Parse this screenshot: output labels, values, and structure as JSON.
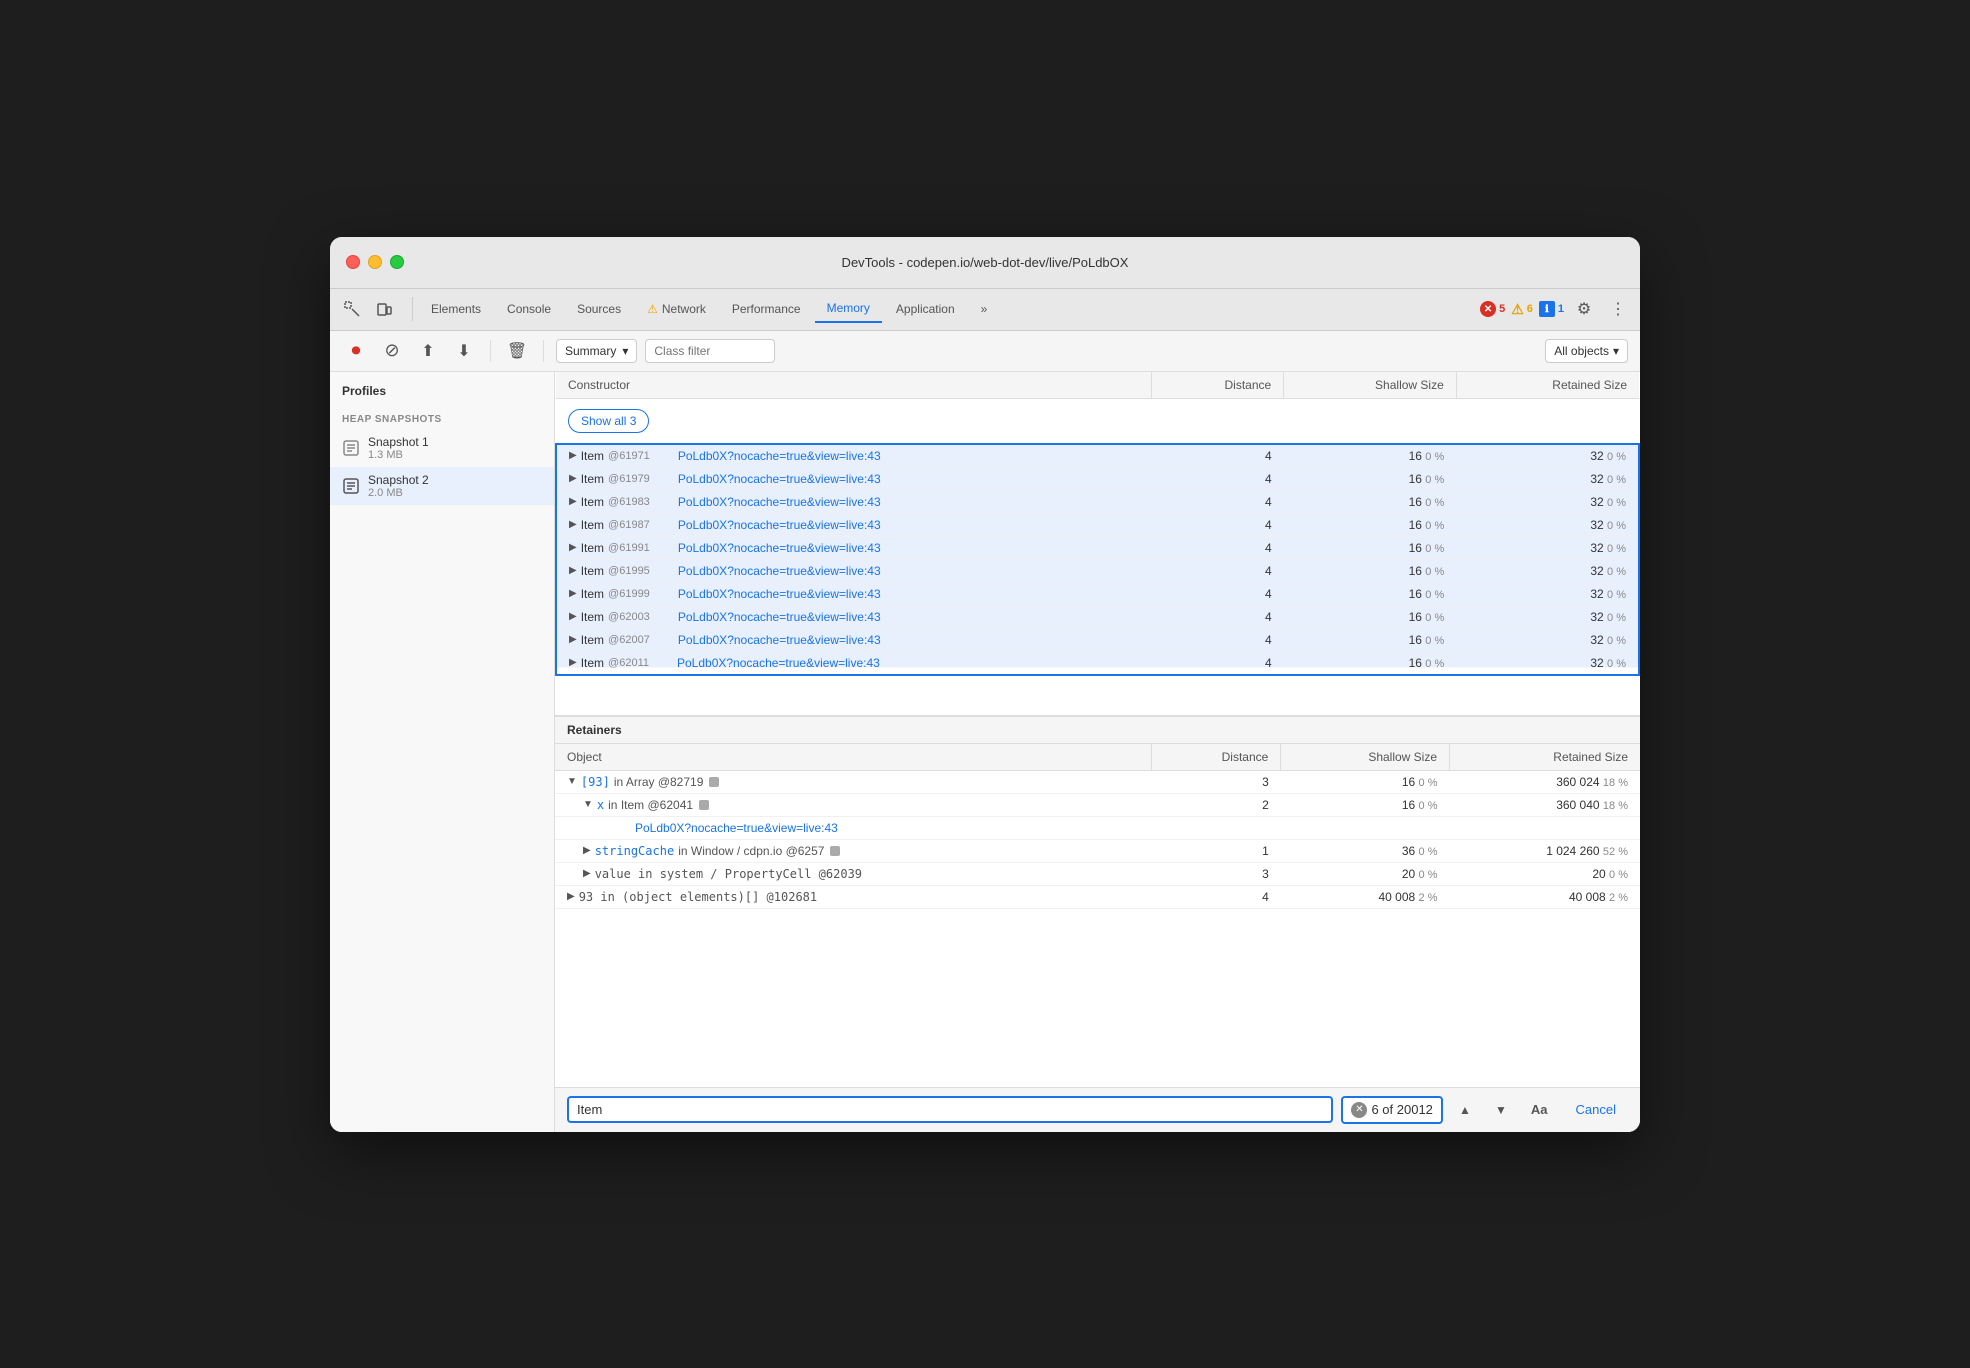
{
  "window": {
    "title": "DevTools - codepen.io/web-dot-dev/live/PoLdbOX"
  },
  "tabs": [
    {
      "id": "elements",
      "label": "Elements",
      "active": false
    },
    {
      "id": "console",
      "label": "Console",
      "active": false
    },
    {
      "id": "sources",
      "label": "Sources",
      "active": false
    },
    {
      "id": "network",
      "label": "Network",
      "active": false,
      "warning": true
    },
    {
      "id": "performance",
      "label": "Performance",
      "active": false
    },
    {
      "id": "memory",
      "label": "Memory",
      "active": true
    },
    {
      "id": "application",
      "label": "Application",
      "active": false
    }
  ],
  "badges": {
    "errors": "5",
    "warnings": "6",
    "info": "1"
  },
  "toolbar": {
    "summary_label": "Summary",
    "class_filter_placeholder": "Class filter",
    "all_objects_label": "All objects",
    "record_label": "Record",
    "stop_label": "Stop",
    "upload_label": "Load profile",
    "download_label": "Save profile",
    "clear_label": "Clear"
  },
  "sidebar": {
    "profiles_title": "Profiles",
    "heap_snapshots_title": "HEAP SNAPSHOTS",
    "snapshots": [
      {
        "name": "Snapshot 1",
        "size": "1.3 MB"
      },
      {
        "name": "Snapshot 2",
        "size": "2.0 MB",
        "active": true
      }
    ]
  },
  "constructor_table": {
    "headers": [
      "Constructor",
      "Distance",
      "Shallow Size",
      "Retained Size"
    ],
    "show_all_label": "Show all 3",
    "rows": [
      {
        "name": "Item",
        "id": "@61971",
        "link": "PoLdb0X?nocache=true&view=live:43",
        "distance": "4",
        "shallow": "16",
        "shallow_pct": "0 %",
        "retained": "32",
        "retained_pct": "0 %",
        "selected": true
      },
      {
        "name": "Item",
        "id": "@61979",
        "link": "PoLdb0X?nocache=true&view=live:43",
        "distance": "4",
        "shallow": "16",
        "shallow_pct": "0 %",
        "retained": "32",
        "retained_pct": "0 %",
        "selected": true
      },
      {
        "name": "Item",
        "id": "@61983",
        "link": "PoLdb0X?nocache=true&view=live:43",
        "distance": "4",
        "shallow": "16",
        "shallow_pct": "0 %",
        "retained": "32",
        "retained_pct": "0 %",
        "selected": true
      },
      {
        "name": "Item",
        "id": "@61987",
        "link": "PoLdb0X?nocache=true&view=live:43",
        "distance": "4",
        "shallow": "16",
        "shallow_pct": "0 %",
        "retained": "32",
        "retained_pct": "0 %",
        "selected": true
      },
      {
        "name": "Item",
        "id": "@61991",
        "link": "PoLdb0X?nocache=true&view=live:43",
        "distance": "4",
        "shallow": "16",
        "shallow_pct": "0 %",
        "retained": "32",
        "retained_pct": "0 %",
        "selected": true
      },
      {
        "name": "Item",
        "id": "@61995",
        "link": "PoLdb0X?nocache=true&view=live:43",
        "distance": "4",
        "shallow": "16",
        "shallow_pct": "0 %",
        "retained": "32",
        "retained_pct": "0 %",
        "selected": true
      },
      {
        "name": "Item",
        "id": "@61999",
        "link": "PoLdb0X?nocache=true&view=live:43",
        "distance": "4",
        "shallow": "16",
        "shallow_pct": "0 %",
        "retained": "32",
        "retained_pct": "0 %",
        "selected": true
      },
      {
        "name": "Item",
        "id": "@62003",
        "link": "PoLdb0X?nocache=true&view=live:43",
        "distance": "4",
        "shallow": "16",
        "shallow_pct": "0 %",
        "retained": "32",
        "retained_pct": "0 %",
        "selected": true
      },
      {
        "name": "Item",
        "id": "@62007",
        "link": "PoLdb0X?nocache=true&view=live:43",
        "distance": "4",
        "shallow": "16",
        "shallow_pct": "0 %",
        "retained": "32",
        "retained_pct": "0 %",
        "selected": true
      },
      {
        "name": "Item",
        "id": "@62011",
        "link": "PoLdb0X?nocache=true&view=live:43",
        "distance": "4",
        "shallow": "16",
        "shallow_pct": "0 %",
        "retained": "32",
        "retained_pct": "0 %",
        "selected": true,
        "partial": true
      }
    ]
  },
  "retainers_table": {
    "title": "Retainers",
    "headers": [
      "Object",
      "Distance",
      "Shallow Size",
      "Retained Size"
    ],
    "rows": [
      {
        "object": "[93] in Array @82719",
        "object_link": false,
        "icon": true,
        "indent": 0,
        "expand": "▼",
        "distance": "3",
        "shallow": "16",
        "shallow_pct": "0 %",
        "retained": "360 024",
        "retained_pct": "18 %"
      },
      {
        "object": "x in Item @62041",
        "object_link": false,
        "icon": true,
        "indent": 1,
        "expand": "▼",
        "distance": "2",
        "shallow": "16",
        "shallow_pct": "0 %",
        "retained": "360 040",
        "retained_pct": "18 %"
      },
      {
        "object": "PoLdb0X?nocache=true&view=live:43",
        "object_link": true,
        "indent": 2,
        "expand": "",
        "distance": "",
        "shallow": "",
        "shallow_pct": "",
        "retained": "",
        "retained_pct": ""
      },
      {
        "object": "stringCache in Window / cdpn.io @6257",
        "object_link": false,
        "icon": true,
        "indent": 1,
        "expand": "▶",
        "distance": "1",
        "shallow": "36",
        "shallow_pct": "0 %",
        "retained": "1 024 260",
        "retained_pct": "52 %"
      },
      {
        "object": "value in system / PropertyCell @62039",
        "object_link": false,
        "icon": false,
        "indent": 1,
        "expand": "▶",
        "distance": "3",
        "shallow": "20",
        "shallow_pct": "0 %",
        "retained": "20",
        "retained_pct": "0 %"
      },
      {
        "object": "93 in (object elements)[] @102681",
        "object_link": false,
        "icon": false,
        "indent": 0,
        "expand": "▶",
        "distance": "4",
        "shallow": "40 008",
        "shallow_pct": "2 %",
        "retained": "40 008",
        "retained_pct": "2 %"
      }
    ]
  },
  "search": {
    "value": "Item",
    "result": "6 of 20012",
    "of_label": "of 20012",
    "match_case_label": "Aa",
    "cancel_label": "Cancel"
  },
  "colors": {
    "accent": "#1a73e8",
    "selected_bg": "#e8f0fe",
    "border_selected": "#1a73e8"
  }
}
